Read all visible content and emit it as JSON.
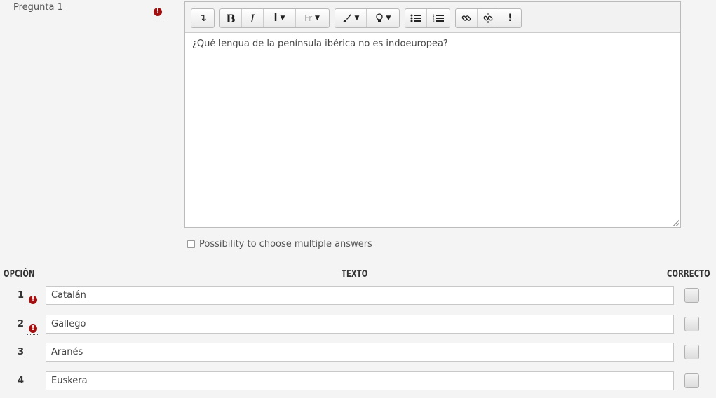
{
  "question": {
    "label": "Pregunta 1",
    "text": "¿Qué lengua de la península ibérica no es indoeuropea?"
  },
  "toolbar": {
    "arrow_glyph": "↴",
    "bold": "B",
    "italic": "I",
    "info": "i",
    "font": "Fr",
    "exclaim": "!"
  },
  "multiple_answers_label": "Possibility to choose multiple answers",
  "columns": {
    "option": "OPCIÓN",
    "text": "TEXTO",
    "correct": "CORRECTO"
  },
  "options": [
    {
      "num": "1",
      "text": "Catalán",
      "required": true,
      "correct": false
    },
    {
      "num": "2",
      "text": "Gallego",
      "required": true,
      "correct": false
    },
    {
      "num": "3",
      "text": "Aranés",
      "required": false,
      "correct": false
    },
    {
      "num": "4",
      "text": "Euskera",
      "required": false,
      "correct": false
    }
  ],
  "colors": {
    "required": "#a01010",
    "background": "#f4f4f4"
  }
}
